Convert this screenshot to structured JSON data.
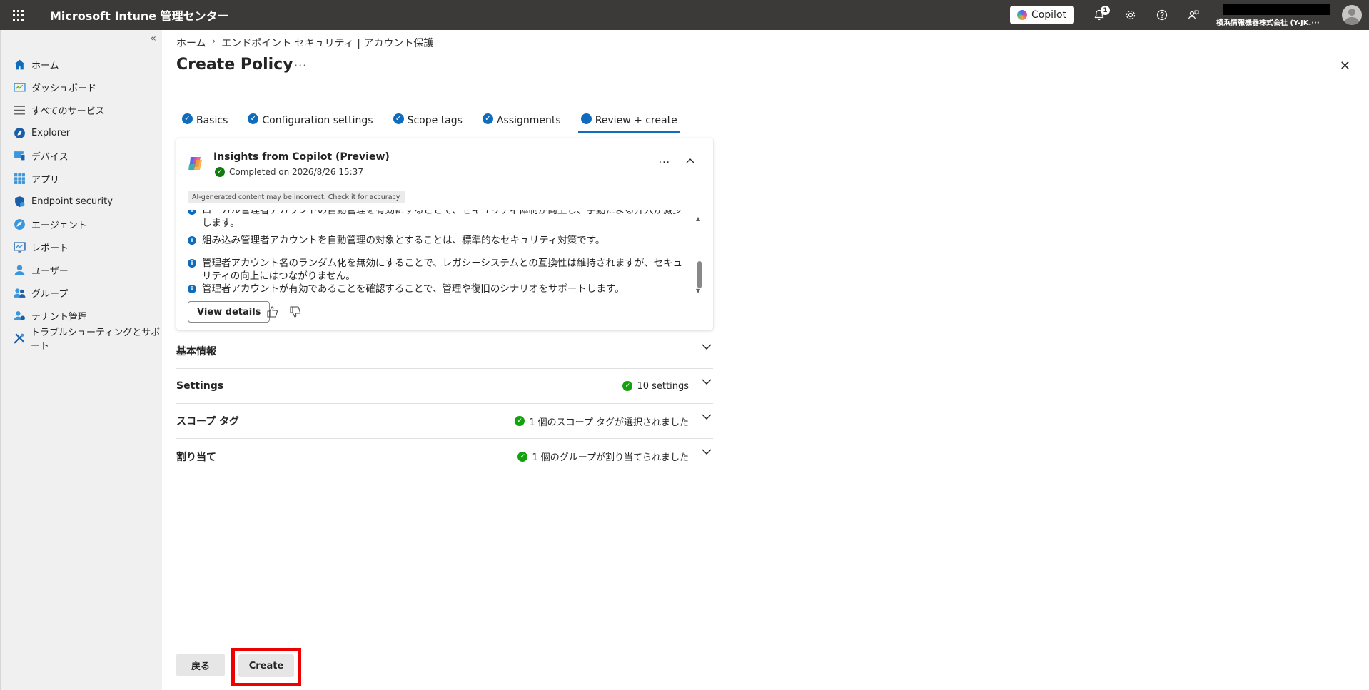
{
  "app": {
    "title": "Microsoft Intune 管理センター"
  },
  "topbar": {
    "copilot_label": "Copilot",
    "notification_count": "1",
    "account_org": "横浜情報機器株式会社 (Y-JK.···"
  },
  "sidebar": {
    "collapse_label": "«",
    "items": [
      {
        "label": "ホーム",
        "icon": "home-icon"
      },
      {
        "label": "ダッシュボード",
        "icon": "dashboard-icon"
      },
      {
        "label": "すべてのサービス",
        "icon": "list-icon"
      },
      {
        "label": "Explorer",
        "icon": "explorer-icon"
      },
      {
        "label": "デバイス",
        "icon": "device-icon"
      },
      {
        "label": "アプリ",
        "icon": "apps-icon"
      },
      {
        "label": "Endpoint security",
        "icon": "shield-icon"
      },
      {
        "label": "エージェント",
        "icon": "agent-icon"
      },
      {
        "label": "レポート",
        "icon": "report-icon"
      },
      {
        "label": "ユーザー",
        "icon": "user-icon"
      },
      {
        "label": "グループ",
        "icon": "group-icon"
      },
      {
        "label": "テナント管理",
        "icon": "tenant-icon"
      },
      {
        "label": "トラブルシューティングとサポート",
        "icon": "tools-icon"
      }
    ]
  },
  "breadcrumb": {
    "items": [
      "ホーム",
      "エンドポイント セキュリティ | アカウント保護"
    ],
    "separator": "›"
  },
  "page": {
    "title": "Create Policy",
    "more": "···",
    "close": "✕"
  },
  "tabs": [
    {
      "label": "Basics",
      "state": "done"
    },
    {
      "label": "Configuration settings",
      "state": "done"
    },
    {
      "label": "Scope tags",
      "state": "done"
    },
    {
      "label": "Assignments",
      "state": "done"
    },
    {
      "label": "Review + create",
      "state": "active"
    }
  ],
  "copilot_card": {
    "title": "Insights from Copilot (Preview)",
    "status": "Completed on 2026/8/26 15:37",
    "more": "···",
    "ai_note": "AI-generated content may be incorrect. Check it for accuracy.",
    "insights": [
      "ローカル管理者アカウントの自動管理を有効にすることで、セキュリティ体制が向上し、手動による介入が減少します。",
      "組み込み管理者アカウントを自動管理の対象とすることは、標準的なセキュリティ対策です。",
      "管理者アカウント名のランダム化を無効にすることで、レガシーシステムとの互換性は維持されますが、セキュリティの向上にはつながりません。",
      "管理者アカウントが有効であることを確認することで、管理や復旧のシナリオをサポートします。"
    ],
    "view_details": "View details"
  },
  "sections": [
    {
      "title": "基本情報",
      "status": ""
    },
    {
      "title": "Settings",
      "status": "10 settings"
    },
    {
      "title": "スコープ タグ",
      "status": "1 個のスコープ タグが選択されました"
    },
    {
      "title": "割り当て",
      "status": "1 個のグループが割り当てられました"
    }
  ],
  "footer": {
    "back_label": "戻る",
    "create_label": "Create"
  },
  "colors": {
    "topbar": "#3b3a39",
    "accent": "#0f6cbd",
    "success": "#107c10",
    "highlight": "#ee0000"
  }
}
